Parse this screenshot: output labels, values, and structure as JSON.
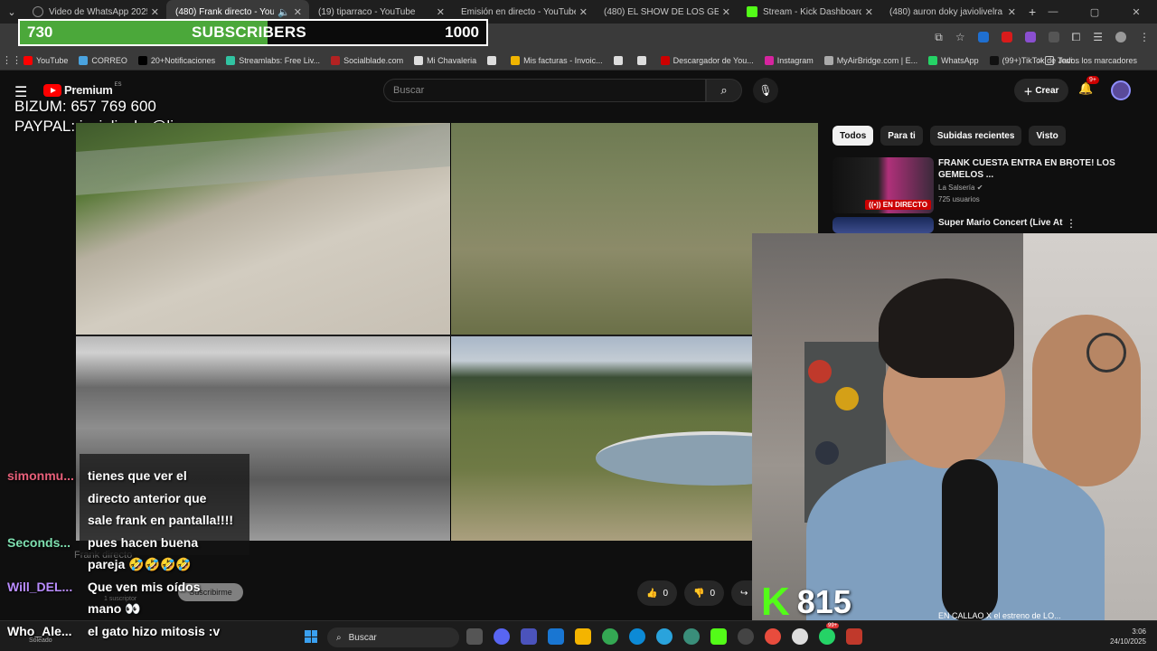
{
  "browser": {
    "tabs": [
      {
        "label": "Video de WhatsApp 2025-10-2",
        "favicon": "whatsapp-icon",
        "active": false
      },
      {
        "label": "(480) Frank directo - YouTu",
        "favicon": "youtube-icon",
        "active": true
      },
      {
        "label": "(19) tiparraco - YouTube",
        "favicon": "youtube-icon",
        "active": false
      },
      {
        "label": "Emisión en directo - YouTube S",
        "favicon": "youtube-icon",
        "active": false
      },
      {
        "label": "(480) EL SHOW DE LOS GEMELO",
        "favicon": "youtube-icon",
        "active": false
      },
      {
        "label": "Stream - Kick Dashboard",
        "favicon": "kick-icon",
        "active": false
      },
      {
        "label": "(480) auron doky javiolivelra - Y",
        "favicon": "youtube-icon",
        "active": false
      }
    ],
    "bookmarks": [
      {
        "label": "YouTube",
        "color": "#ff0000"
      },
      {
        "label": "CORREO",
        "color": "#4aa3df"
      },
      {
        "label": "20+Notificaciones",
        "color": "#000000"
      },
      {
        "label": "Streamlabs: Free Liv...",
        "color": "#31c3a2"
      },
      {
        "label": "Socialblade.com",
        "color": "#b22222"
      },
      {
        "label": "Mi Chavaleria",
        "color": "#dddddd"
      },
      {
        "label": "",
        "color": "#dddddd"
      },
      {
        "label": "Mis facturas - Invoic...",
        "color": "#f0b400"
      },
      {
        "label": "",
        "color": "#dddddd"
      },
      {
        "label": "",
        "color": "#dddddd"
      },
      {
        "label": "Descargador de You...",
        "color": "#cc0000"
      },
      {
        "label": "Instagram",
        "color": "#d6249f"
      },
      {
        "label": "MyAirBridge.com | E...",
        "color": "#aaaaaa"
      },
      {
        "label": "WhatsApp",
        "color": "#25d366"
      },
      {
        "label": "(99+)TikTok de Javi...",
        "color": "#111111"
      }
    ],
    "all_bookmarks": "Todos los marcadores"
  },
  "overlay": {
    "sub_current": "730",
    "sub_label": "SUBSCRIBERS",
    "sub_goal": "1000",
    "sub_progress": 0.73,
    "bizum": "BIZUM: 657 769 600",
    "paypal": "PAYPAL: javiolivelra@live.com",
    "kick_letter": "K",
    "kick_count": "815"
  },
  "youtube": {
    "logo_text": "Premium",
    "logo_region": "ES",
    "search_placeholder": "Buscar",
    "create_label": "Crear",
    "notif_badge": "9+",
    "video_title": "Frank directo",
    "channel_subs": "1 suscriptor",
    "subscribe_label": "Suscribirme",
    "like_count": "0",
    "dislike_count": "0",
    "share_label": "Co",
    "chips": [
      "Todos",
      "Para ti",
      "Subidas recientes",
      "Visto"
    ],
    "recommendations": [
      {
        "title": "FRANK CUESTA ENTRA EN BROTE! LOS GEMELOS ...",
        "channel": "La Salsería",
        "views": "725 usuarios",
        "badge": "EN DIRECTO"
      },
      {
        "title": "Super Mario Concert (Live At",
        "channel": "",
        "views": "",
        "badge": ""
      }
    ],
    "bottom_rec": "EN CALLAO X el estreno de LO..."
  },
  "chat": [
    {
      "name": "simonmu...",
      "color": "#e8607a",
      "text": "tienes que ver el"
    },
    {
      "name": "",
      "color": "#ffffff",
      "text": "directo anterior que"
    },
    {
      "name": "",
      "color": "#ffffff",
      "text": "sale frank en pantalla!!!!"
    },
    {
      "name": "Seconds...",
      "color": "#7ee0b0",
      "text": "pues hacen buena"
    },
    {
      "name": "",
      "color": "#ffffff",
      "text": "pareja 🤣🤣🤣🤣"
    },
    {
      "name": "Will_DEL...",
      "color": "#b98cff",
      "text": "Que ven mis oídos"
    },
    {
      "name": "",
      "color": "#ffffff",
      "text": "mano 👀"
    },
    {
      "name": "Who_Ale...",
      "color": "#ffffff",
      "text": "el gato hizo mitosis :v"
    }
  ],
  "taskbar": {
    "search_label": "Buscar",
    "time": "3:06",
    "date": "24/10/2025",
    "weather": "Soleado",
    "badge": "99+"
  }
}
